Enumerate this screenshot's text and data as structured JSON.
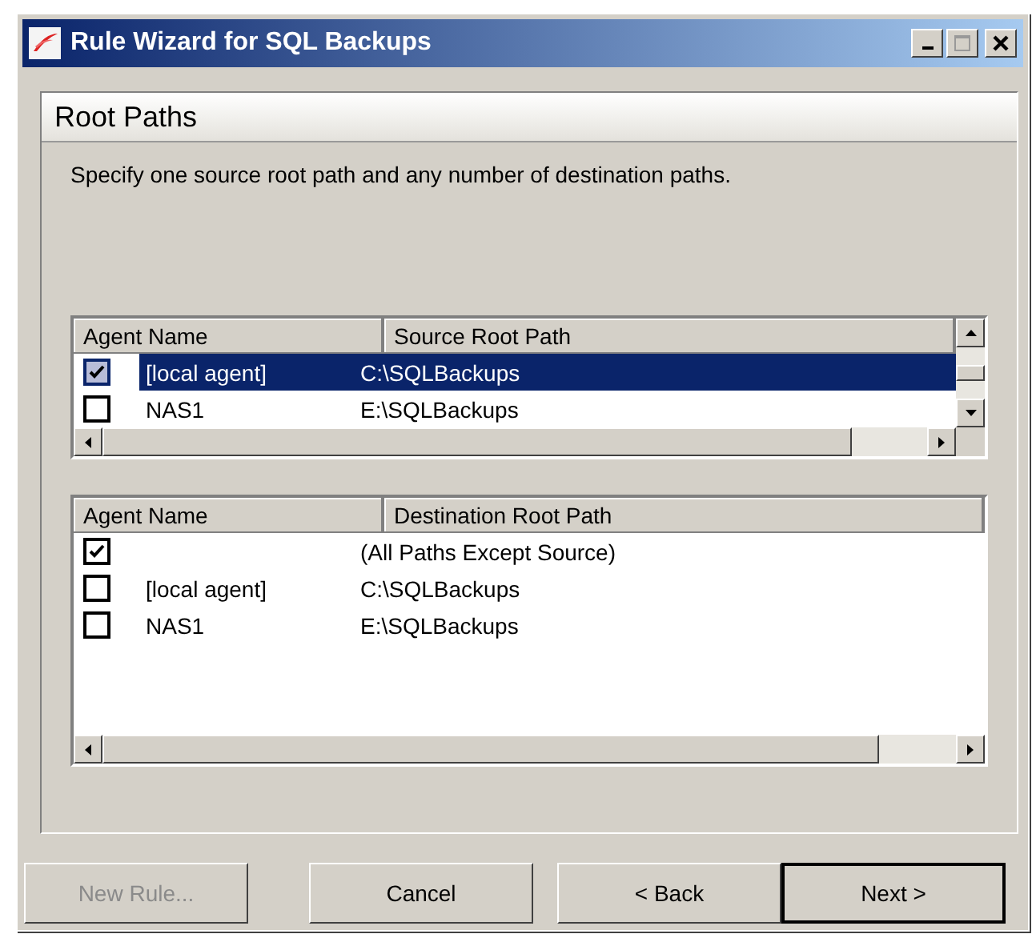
{
  "window": {
    "title": "Rule Wizard for SQL Backups"
  },
  "page": {
    "title": "Root Paths",
    "description": "Specify one source root path and any number of destination paths."
  },
  "source_table": {
    "columns": [
      "Agent Name",
      "Source Root Path"
    ],
    "rows": [
      {
        "checked": true,
        "selected": true,
        "agent": "[local agent]",
        "path": "C:\\SQLBackups"
      },
      {
        "checked": false,
        "selected": false,
        "agent": "NAS1",
        "path": "E:\\SQLBackups"
      }
    ]
  },
  "destination_table": {
    "columns": [
      "Agent Name",
      "Destination Root Path"
    ],
    "rows": [
      {
        "checked": true,
        "selected": false,
        "agent": "",
        "path": "(All Paths Except Source)"
      },
      {
        "checked": false,
        "selected": false,
        "agent": "[local agent]",
        "path": "C:\\SQLBackups"
      },
      {
        "checked": false,
        "selected": false,
        "agent": "NAS1",
        "path": "E:\\SQLBackups"
      }
    ]
  },
  "buttons": [
    {
      "label": "New Rule...",
      "disabled": true,
      "default": false
    },
    {
      "label": "Cancel",
      "disabled": false,
      "default": false
    },
    {
      "label": "< Back",
      "disabled": false,
      "default": false
    },
    {
      "label": "Next >",
      "disabled": false,
      "default": true
    }
  ]
}
